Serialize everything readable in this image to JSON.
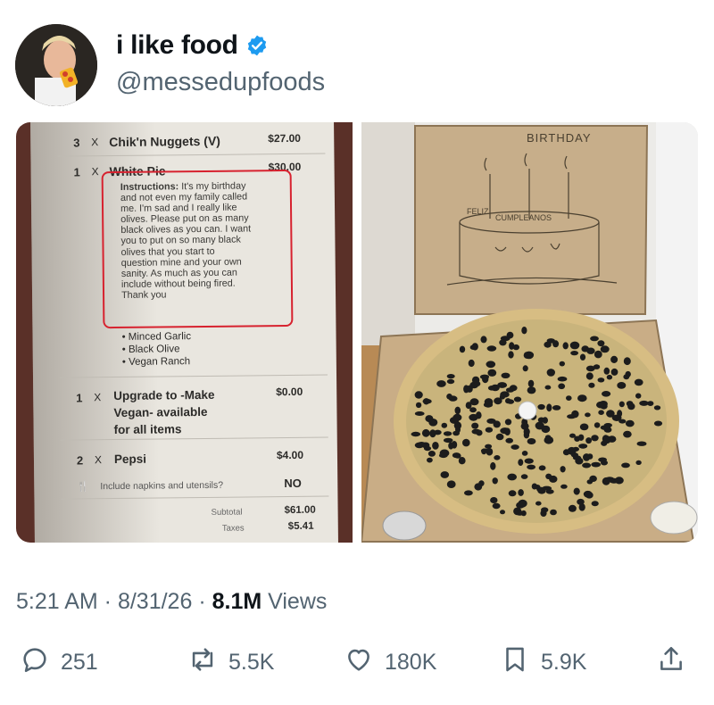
{
  "author": {
    "display_name": "i like food",
    "handle": "@messedupfoods",
    "verified": true
  },
  "receipt": {
    "items": [
      {
        "qty": "3",
        "x": "X",
        "name": "Chik'n Nuggets (V)",
        "price": "$27.00"
      },
      {
        "qty": "1",
        "x": "X",
        "name": "White Pie",
        "price": "$30.00"
      }
    ],
    "instructions_label": "Instructions:",
    "instructions_lines": [
      " It's my birthday",
      "and not even my family called",
      "me. I'm sad and I really like",
      "olives. Please put on as many",
      "black olives as you can. I want",
      "you to put on so many black",
      "olives that you start to",
      "question mine and your own",
      "sanity. As much as you can",
      "include without being fired.",
      "Thank you"
    ],
    "toppings": [
      "• Minced Garlic",
      "• Black Olive",
      "• Vegan Ranch"
    ],
    "upgrade": {
      "qty": "1",
      "x": "X",
      "lines": [
        "Upgrade to -Make",
        "Vegan- available",
        "for all items"
      ],
      "price": "$0.00"
    },
    "pepsi": {
      "qty": "2",
      "x": "X",
      "name": "Pepsi",
      "price": "$4.00"
    },
    "napkins": {
      "label": "Include napkins and utensils?",
      "value": "NO"
    },
    "subtotal": {
      "label": "Subtotal",
      "value": "$61.00"
    },
    "taxes": {
      "label": "Taxes",
      "value": "$5.41"
    }
  },
  "pizza_box": {
    "lid_text": "BIRTHDAY",
    "cake_text_left": "FELIZ",
    "cake_text_right": "CUMPLEANOS"
  },
  "meta": {
    "time": "5:21 AM",
    "dot1": " · ",
    "date": "8/31/26",
    "dot2": " · ",
    "views_count": "8.1M",
    "views_label": " Views"
  },
  "actions": {
    "replies": "251",
    "reposts": "5.5K",
    "likes": "180K",
    "bookmarks": "5.9K"
  },
  "colors": {
    "verified_blue": "#1d9bf0",
    "secondary_text": "#536471",
    "highlight_red": "#d7222f"
  }
}
